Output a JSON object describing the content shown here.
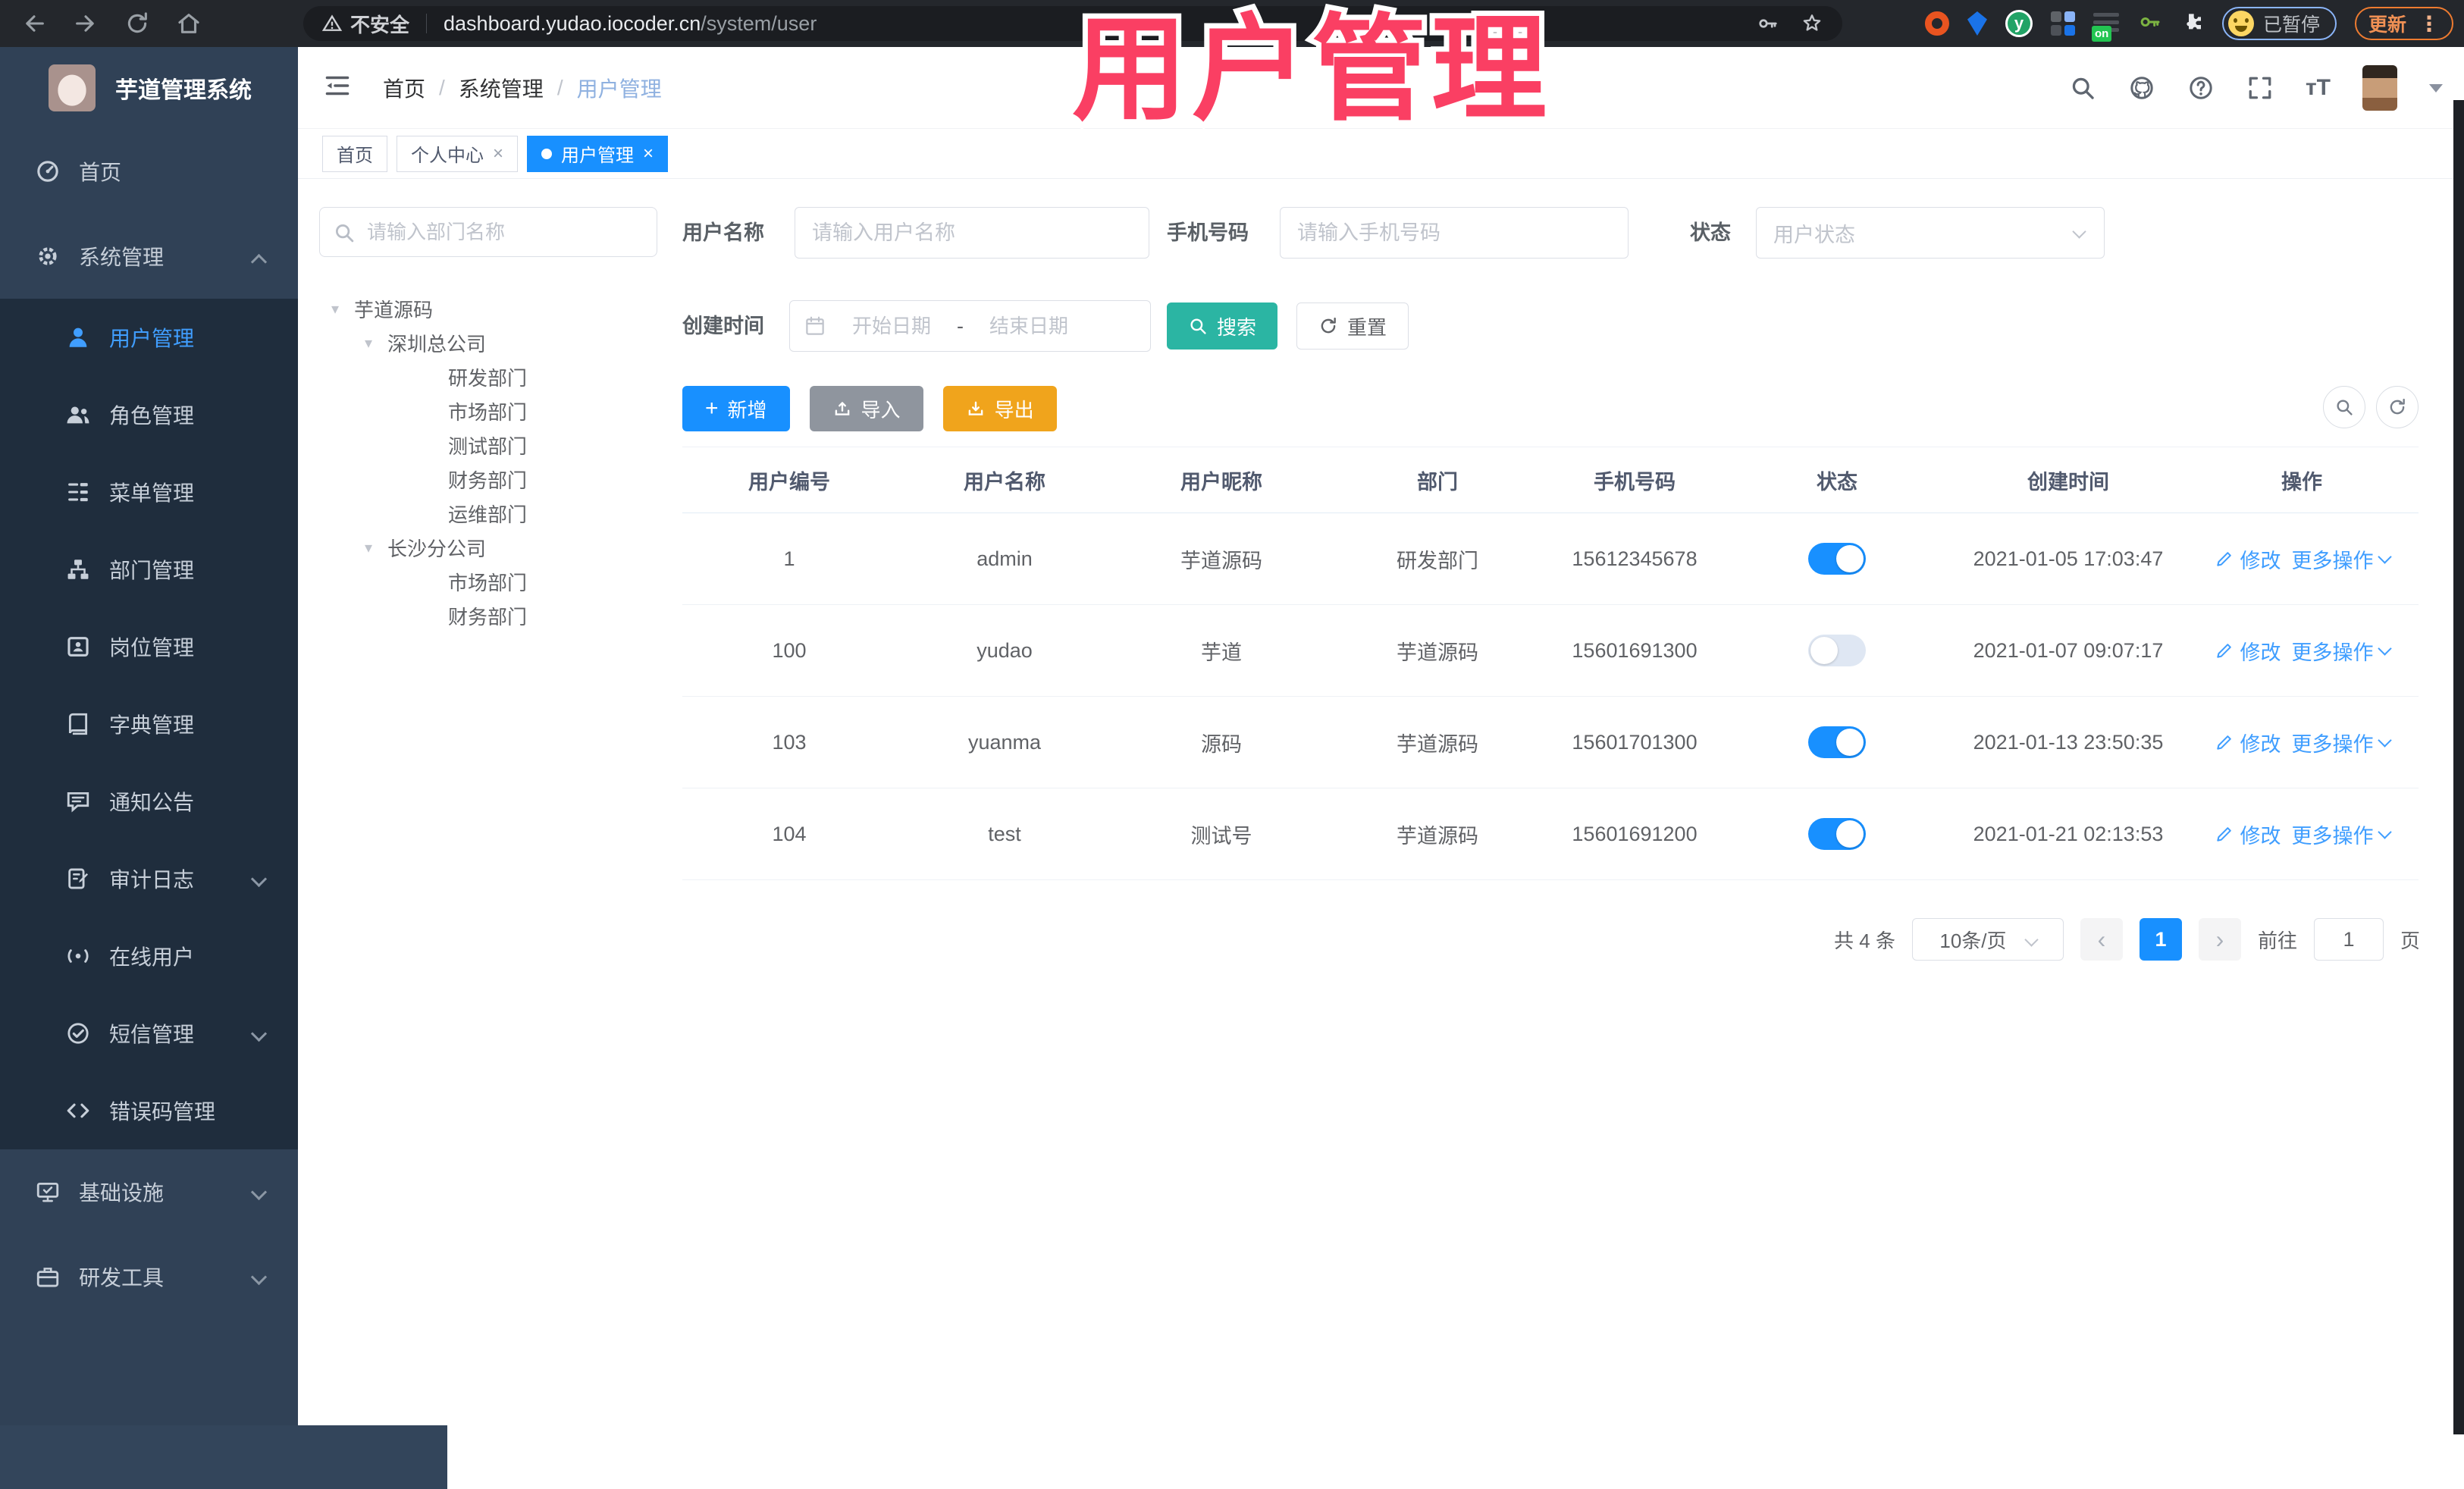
{
  "browser": {
    "security_label": "不安全",
    "url_host": "dashboard.yudao.iocoder.cn",
    "url_path": "/system/user",
    "extension_badge": "on",
    "extension_y_letter": "y",
    "profile_status": "已暂停",
    "update_label": "更新"
  },
  "watermark": {
    "text": "用户管理",
    "color": "#fa3f63"
  },
  "app": {
    "logo_title": "芋道管理系统",
    "breadcrumb": {
      "items": [
        "首页",
        "系统管理",
        "用户管理"
      ]
    },
    "tabs": [
      {
        "label": "首页",
        "closable": false,
        "active": false
      },
      {
        "label": "个人中心",
        "closable": true,
        "active": false
      },
      {
        "label": "用户管理",
        "closable": true,
        "active": true
      }
    ],
    "sidebar": {
      "items": [
        {
          "key": "home",
          "label": "首页",
          "icon": "dashboard-icon",
          "level": "top"
        },
        {
          "key": "system",
          "label": "系统管理",
          "icon": "gear-icon",
          "level": "top",
          "chevron": "up"
        },
        {
          "key": "user",
          "label": "用户管理",
          "icon": "user-icon",
          "level": "sub",
          "active": true
        },
        {
          "key": "role",
          "label": "角色管理",
          "icon": "users-icon",
          "level": "sub"
        },
        {
          "key": "menu",
          "label": "菜单管理",
          "icon": "menu-list-icon",
          "level": "sub"
        },
        {
          "key": "dept",
          "label": "部门管理",
          "icon": "org-tree-icon",
          "level": "sub"
        },
        {
          "key": "post",
          "label": "岗位管理",
          "icon": "badge-icon",
          "level": "sub"
        },
        {
          "key": "dict",
          "label": "字典管理",
          "icon": "book-icon",
          "level": "sub"
        },
        {
          "key": "notice",
          "label": "通知公告",
          "icon": "message-icon",
          "level": "sub"
        },
        {
          "key": "audit",
          "label": "审计日志",
          "icon": "audit-log-icon",
          "level": "sub",
          "chevron": "down"
        },
        {
          "key": "online",
          "label": "在线用户",
          "icon": "online-users-icon",
          "level": "sub"
        },
        {
          "key": "sms",
          "label": "短信管理",
          "icon": "sms-icon",
          "level": "sub",
          "chevron": "down"
        },
        {
          "key": "errcode",
          "label": "错误码管理",
          "icon": "code-icon",
          "level": "sub"
        },
        {
          "key": "infra",
          "label": "基础设施",
          "icon": "infra-icon",
          "level": "top",
          "chevron": "down"
        },
        {
          "key": "tools",
          "label": "研发工具",
          "icon": "dev-tools-icon",
          "level": "top",
          "chevron": "down"
        }
      ]
    },
    "tree": {
      "search_placeholder": "请输入部门名称",
      "nodes": [
        {
          "label": "芋道源码",
          "level": 0,
          "caret": true
        },
        {
          "label": "深圳总公司",
          "level": 1,
          "caret": true
        },
        {
          "label": "研发部门",
          "level": 2,
          "caret": false
        },
        {
          "label": "市场部门",
          "level": 2,
          "caret": false
        },
        {
          "label": "测试部门",
          "level": 2,
          "caret": false
        },
        {
          "label": "财务部门",
          "level": 2,
          "caret": false
        },
        {
          "label": "运维部门",
          "level": 2,
          "caret": false
        },
        {
          "label": "长沙分公司",
          "level": 1,
          "caret": true
        },
        {
          "label": "市场部门",
          "level": 2,
          "caret": false
        },
        {
          "label": "财务部门",
          "level": 2,
          "caret": false
        }
      ]
    },
    "filters": {
      "username_label": "用户名称",
      "username_placeholder": "请输入用户名称",
      "mobile_label": "手机号码",
      "mobile_placeholder": "请输入手机号码",
      "status_label": "状态",
      "status_placeholder": "用户状态",
      "created_label": "创建时间",
      "date_start_placeholder": "开始日期",
      "date_separator": "-",
      "date_end_placeholder": "结束日期",
      "search_label": "搜索",
      "reset_label": "重置"
    },
    "toolbar": {
      "add_label": "新增",
      "import_label": "导入",
      "export_label": "导出"
    },
    "table": {
      "columns": [
        "用户编号",
        "用户名称",
        "用户昵称",
        "部门",
        "手机号码",
        "状态",
        "创建时间",
        "操作"
      ],
      "edit_label": "修改",
      "more_label": "更多操作",
      "rows": [
        {
          "id": "1",
          "username": "admin",
          "nickname": "芋道源码",
          "dept": "研发部门",
          "mobile": "15612345678",
          "status": true,
          "created": "2021-01-05 17:03:47"
        },
        {
          "id": "100",
          "username": "yudao",
          "nickname": "芋道",
          "dept": "芋道源码",
          "mobile": "15601691300",
          "status": false,
          "created": "2021-01-07 09:07:17"
        },
        {
          "id": "103",
          "username": "yuanma",
          "nickname": "源码",
          "dept": "芋道源码",
          "mobile": "15601701300",
          "status": true,
          "created": "2021-01-13 23:50:35"
        },
        {
          "id": "104",
          "username": "test",
          "nickname": "测试号",
          "dept": "芋道源码",
          "mobile": "15601691200",
          "status": true,
          "created": "2021-01-21 02:13:53"
        }
      ]
    },
    "pagination": {
      "total_label": "共 4 条",
      "page_size_label": "10条/页",
      "current_page": "1",
      "goto_label": "前往",
      "goto_value": "1",
      "page_unit_label": "页"
    },
    "colors": {
      "accent_blue": "#1890ff",
      "link_blue": "#409EFF",
      "teal": "#2bb5a3",
      "amber": "#f0a41c",
      "sidebar_bg": "#304156",
      "submenu_bg": "#1f2d3d",
      "watermark_pink": "#fa3f63"
    }
  }
}
